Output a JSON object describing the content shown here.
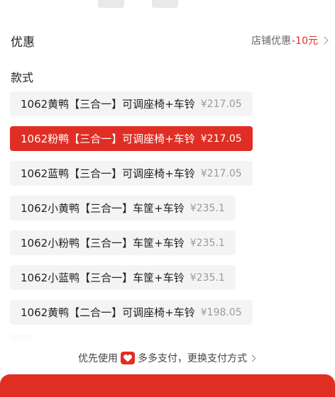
{
  "discount": {
    "label": "优惠",
    "detail_prefix": "店铺优惠",
    "amount": "-10元"
  },
  "style_section": {
    "label": "款式",
    "options": [
      {
        "name": "1062黄鸭【三合一】可调座椅+车铃",
        "price": "¥217.05",
        "selected": false
      },
      {
        "name": "1062粉鸭【三合一】可调座椅+车铃",
        "price": "¥217.05",
        "selected": true
      },
      {
        "name": "1062蓝鸭【三合一】可调座椅+车铃",
        "price": "¥217.05",
        "selected": false
      },
      {
        "name": "1062小黄鸭【三合一】车筐+车铃",
        "price": "¥235.1",
        "selected": false
      },
      {
        "name": "1062小粉鸭【三合一】车筐+车铃",
        "price": "¥235.1",
        "selected": false
      },
      {
        "name": "1062小蓝鸭【三合一】车筐+车铃",
        "price": "¥235.1",
        "selected": false
      },
      {
        "name": "1062黄鸭【二合一】可调座椅+车铃",
        "price": "¥198.05",
        "selected": false
      }
    ]
  },
  "payment": {
    "prefix": "优先使用",
    "icon": "heart-icon",
    "method": "多多支付，更换支付方式"
  },
  "colors": {
    "accent": "#e02e24",
    "option_bg": "#f4f4f4"
  }
}
